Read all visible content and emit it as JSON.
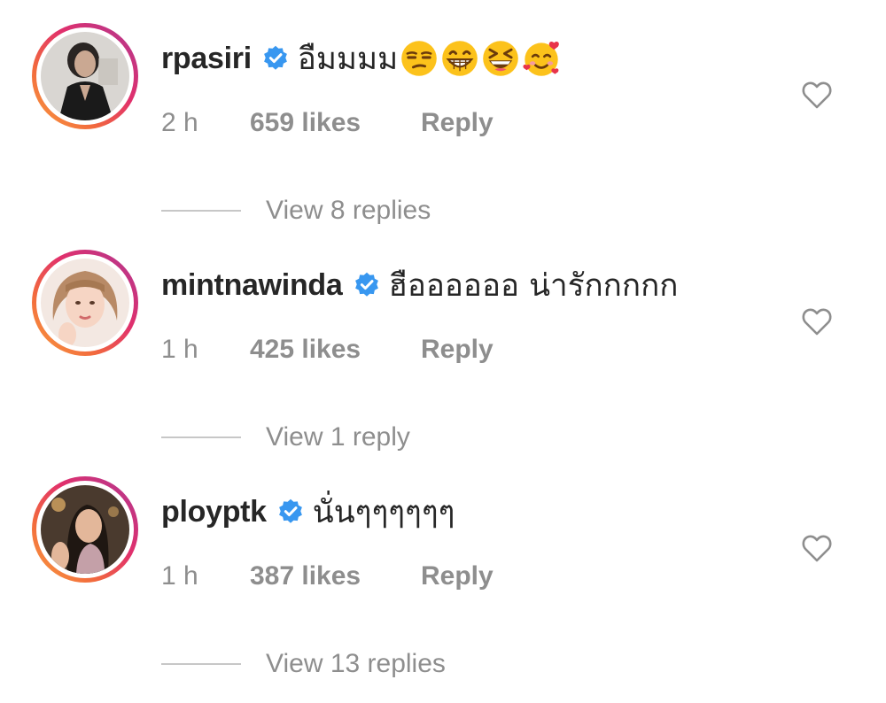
{
  "comments": [
    {
      "username": "rpasiri",
      "verified": true,
      "text": "อืมมมม",
      "emojis": [
        "unamused-face-emoji",
        "grinning-face-emoji",
        "laughing-squinting-face-emoji",
        "smiling-face-with-hearts-emoji"
      ],
      "time": "2 h",
      "likes": "659 likes",
      "reply_label": "Reply",
      "view_replies": "View 8 replies",
      "avatar_icon": "avatar-photo-woman-dark-outfit"
    },
    {
      "username": "mintnawinda",
      "verified": true,
      "text": "ฮืออออออ น่ารักกกกก",
      "emojis": [],
      "time": "1 h",
      "likes": "425 likes",
      "reply_label": "Reply",
      "view_replies": "View 1 reply",
      "avatar_icon": "avatar-photo-woman-light-hair"
    },
    {
      "username": "ployptk",
      "verified": true,
      "text": "นั่นๆๆๆๆๆๆ",
      "emojis": [],
      "time": "1 h",
      "likes": "387 likes",
      "reply_label": "Reply",
      "view_replies": "View 13 replies",
      "avatar_icon": "avatar-photo-woman-dark-hair"
    }
  ],
  "icons": {
    "verified": "verified-badge-icon",
    "like": "heart-outline-icon"
  },
  "colors": {
    "text_primary": "#262626",
    "text_secondary": "#8e8e8e",
    "verified_blue": "#3897f0",
    "story_ring_start": "#f9a03f",
    "story_ring_end": "#a2339a"
  }
}
